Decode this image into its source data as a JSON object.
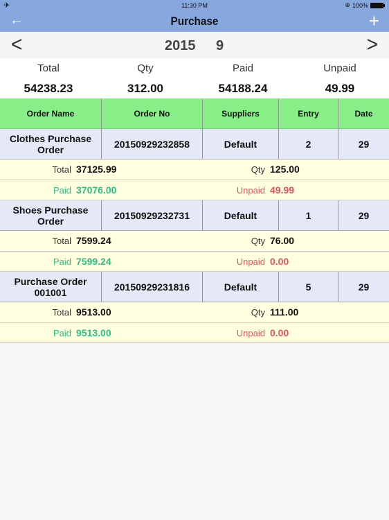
{
  "status_bar": {
    "time": "11:30 PM",
    "battery": "100%",
    "icons": [
      "airplane-icon",
      "orientation-lock-icon",
      "battery-icon"
    ]
  },
  "nav": {
    "title": "Purchase",
    "back_icon": "←",
    "add_icon": "+"
  },
  "period": {
    "prev_icon": "〈",
    "next_icon": "〉",
    "year": "2015",
    "month": "9"
  },
  "summary": {
    "total_label": "Total",
    "total_value": "54238.23",
    "qty_label": "Qty",
    "qty_value": "312.00",
    "paid_label": "Paid",
    "paid_value": "54188.24",
    "unpaid_label": "Unpaid",
    "unpaid_value": "49.99"
  },
  "table": {
    "headers": [
      "Order Name",
      "Order No",
      "Suppliers",
      "Entry",
      "Date"
    ],
    "rows": [
      {
        "name": "Clothes Purchase Order",
        "order_no": "20150929232858",
        "supplier": "Default",
        "entry": "2",
        "date": "29",
        "total_label": "Total",
        "total": "37125.99",
        "qty_label": "Qty",
        "qty": "125.00",
        "paid_label": "Paid",
        "paid": "37076.00",
        "unpaid_label": "Unpaid",
        "unpaid": "49.99"
      },
      {
        "name": "Shoes Purchase Order",
        "order_no": "20150929232731",
        "supplier": "Default",
        "entry": "1",
        "date": "29",
        "total_label": "Total",
        "total": "7599.24",
        "qty_label": "Qty",
        "qty": "76.00",
        "paid_label": "Paid",
        "paid": "7599.24",
        "unpaid_label": "Unpaid",
        "unpaid": "0.00"
      },
      {
        "name": "Purchase Order 001001",
        "order_no": "20150929231816",
        "supplier": "Default",
        "entry": "5",
        "date": "29",
        "total_label": "Total",
        "total": "9513.00",
        "qty_label": "Qty",
        "qty": "111.00",
        "paid_label": "Paid",
        "paid": "9513.00",
        "unpaid_label": "Unpaid",
        "unpaid": "0.00"
      }
    ]
  },
  "colors": {
    "nav_bg": "#87a8df",
    "header_bg": "#88ee88",
    "order_row_bg": "#e5e9f7",
    "sub_row_bg": "#ffffe0",
    "paid_color": "#2bbf83",
    "unpaid_color": "#e0535e"
  }
}
